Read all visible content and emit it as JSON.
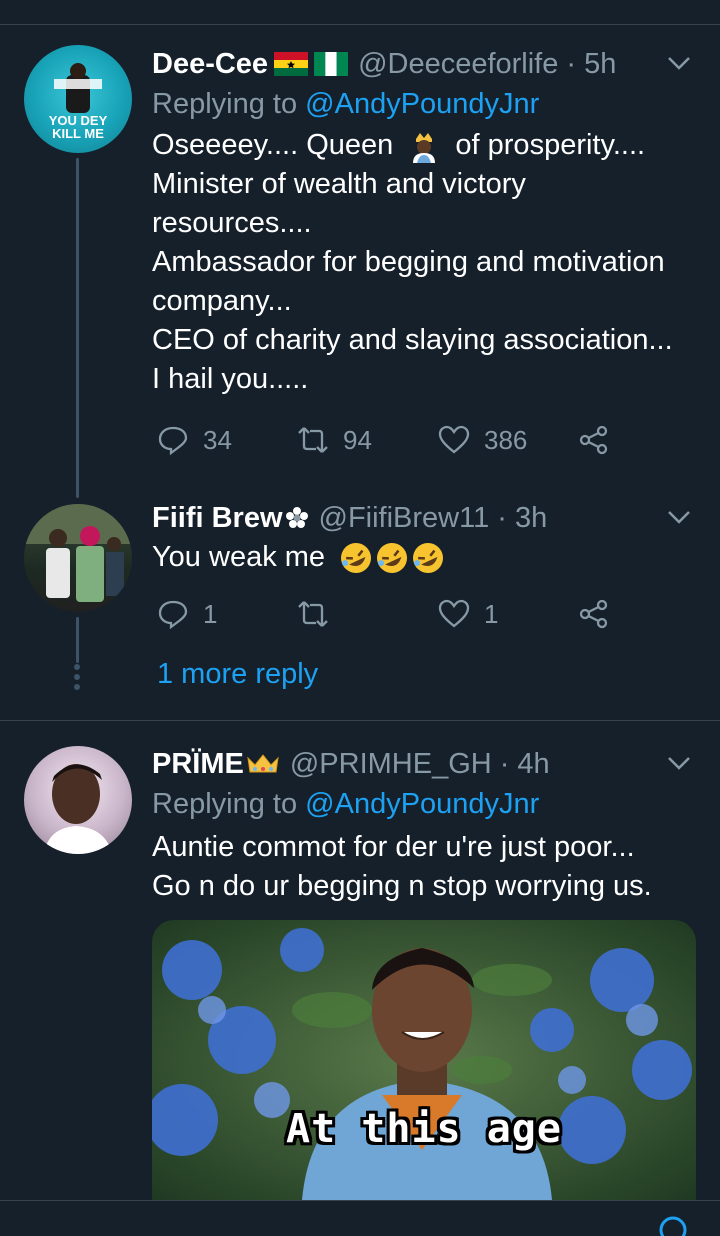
{
  "tweets": [
    {
      "name": "Dee-Cee",
      "handle": "@Deeceeforlife",
      "time": "· 5h",
      "replying_prefix": "Replying to ",
      "replying_to": "@AndyPoundyJnr",
      "text_lines": [
        "Oseeeey.... Queen",
        "of prosperity....",
        "Minister of wealth and victory",
        "resources....",
        "Ambassador for begging and motivation",
        "company...",
        "CEO of charity and slaying association...",
        "I hail you....."
      ],
      "avatar_text": [
        "YOU DEY",
        "KILL ME"
      ],
      "replies": "34",
      "retweets": "94",
      "likes": "386"
    },
    {
      "name": "Fiifi Brew",
      "handle": "@FiifiBrew11",
      "time": "· 3h",
      "text": "You weak me",
      "replies": "1",
      "retweets": "",
      "likes": "1",
      "more_reply": "1 more reply"
    },
    {
      "name": "PRÏME",
      "handle": "@PRIMHE_GH",
      "time": "· 4h",
      "replying_prefix": "Replying to ",
      "replying_to": "@AndyPoundyJnr",
      "text_lines": [
        "Auntie commot for der u're just poor...",
        "Go n do ur begging n stop worrying us."
      ],
      "media_caption": "At this age"
    }
  ],
  "colors": {
    "background": "#15202b",
    "divider": "#38444d",
    "secondary_text": "#8899a6",
    "link": "#1da1f2"
  }
}
